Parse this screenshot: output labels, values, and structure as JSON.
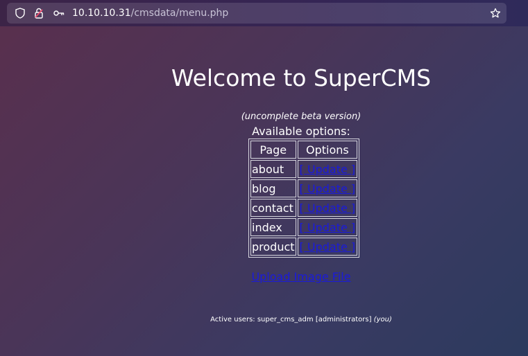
{
  "browser": {
    "url_host": "10.10.10.31",
    "url_path": "/cmsdata/menu.php",
    "icons": [
      "shield-icon",
      "lock-warning-icon",
      "key-icon",
      "star-icon"
    ]
  },
  "page": {
    "title": "Welcome to SuperCMS",
    "subtitle": "(uncomplete beta version)",
    "options_label": "Available options:",
    "table": {
      "headers": [
        "Page",
        "Options"
      ],
      "rows": [
        {
          "page": "about",
          "option": "[ Update ]"
        },
        {
          "page": "blog",
          "option": "[ Update ]"
        },
        {
          "page": "contact",
          "option": "[ Update ]"
        },
        {
          "page": "index",
          "option": "[ Update ]"
        },
        {
          "page": "product",
          "option": "[ Update ]"
        }
      ]
    },
    "upload_link": "Upload Image File",
    "footer": {
      "prefix": "Active users: super_cms_adm [administrators]",
      "you": "(you)"
    }
  },
  "colors": {
    "link": "#1a1adb",
    "text": "#ffffff",
    "background_start": "#5a2f4d",
    "background_end": "#2c3a5e"
  }
}
